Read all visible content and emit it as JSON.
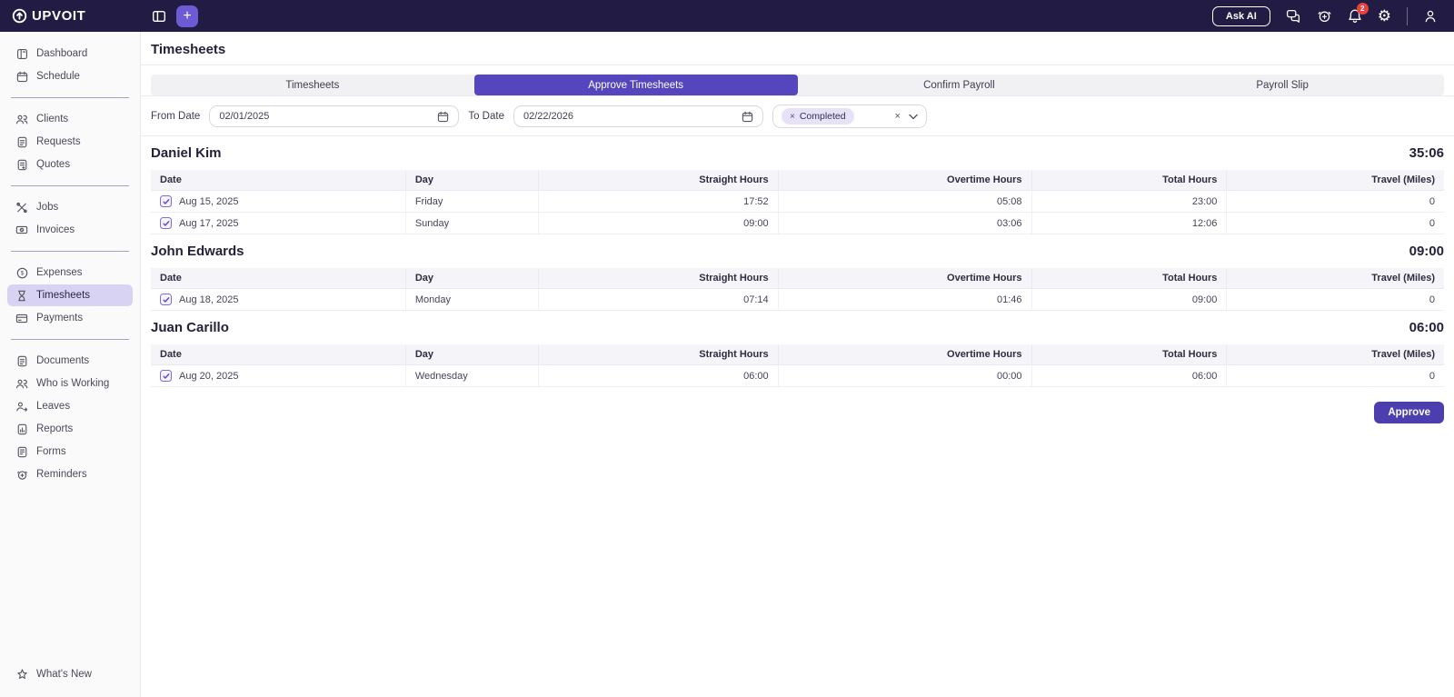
{
  "brand": {
    "name": "UPVOIT"
  },
  "topbar": {
    "ask_ai_label": "Ask AI",
    "notification_count": "2",
    "icons": [
      "panel-toggle-icon",
      "plus-icon",
      "chat-icon",
      "alarm-icon",
      "bell-icon",
      "gear-icon",
      "user-icon"
    ]
  },
  "sidebar": {
    "groups": [
      {
        "items": [
          {
            "label": "Dashboard",
            "icon": "dashboard-icon"
          },
          {
            "label": "Schedule",
            "icon": "schedule-icon"
          }
        ]
      },
      {
        "items": [
          {
            "label": "Clients",
            "icon": "clients-icon"
          },
          {
            "label": "Requests",
            "icon": "requests-icon"
          },
          {
            "label": "Quotes",
            "icon": "quotes-icon"
          }
        ]
      },
      {
        "items": [
          {
            "label": "Jobs",
            "icon": "jobs-icon"
          },
          {
            "label": "Invoices",
            "icon": "invoices-icon"
          }
        ]
      },
      {
        "items": [
          {
            "label": "Expenses",
            "icon": "expenses-icon"
          },
          {
            "label": "Timesheets",
            "icon": "timesheets-icon",
            "active": true
          },
          {
            "label": "Payments",
            "icon": "payments-icon"
          }
        ]
      },
      {
        "items": [
          {
            "label": "Documents",
            "icon": "documents-icon"
          },
          {
            "label": "Who is Working",
            "icon": "who-is-working-icon"
          },
          {
            "label": "Leaves",
            "icon": "leaves-icon"
          },
          {
            "label": "Reports",
            "icon": "reports-icon"
          },
          {
            "label": "Forms",
            "icon": "forms-icon"
          },
          {
            "label": "Reminders",
            "icon": "reminders-icon"
          }
        ]
      }
    ],
    "footer": {
      "label": "What's New",
      "icon": "whats-new-icon"
    }
  },
  "page": {
    "title": "Timesheets"
  },
  "tabs": [
    {
      "label": "Timesheets",
      "active": false
    },
    {
      "label": "Approve Timesheets",
      "active": true
    },
    {
      "label": "Confirm Payroll",
      "active": false
    },
    {
      "label": "Payroll Slip",
      "active": false
    }
  ],
  "filters": {
    "from_date": {
      "label": "From Date",
      "value": "02/01/2025"
    },
    "to_date": {
      "label": "To Date",
      "value": "02/22/2026"
    },
    "status": {
      "chip_label": "Completed"
    }
  },
  "table": {
    "headers": [
      "Date",
      "Day",
      "Straight Hours",
      "Overtime Hours",
      "Total Hours",
      "Travel (Miles)"
    ]
  },
  "employees": [
    {
      "name": "Daniel Kim",
      "total_hours": "35:06",
      "rows": [
        {
          "date": "Aug 15, 2025",
          "day": "Friday",
          "straight_hours": "17:52",
          "overtime_hours": "05:08",
          "total_hours": "23:00",
          "travel_miles": "0",
          "checked": true
        },
        {
          "date": "Aug 17, 2025",
          "day": "Sunday",
          "straight_hours": "09:00",
          "overtime_hours": "03:06",
          "total_hours": "12:06",
          "travel_miles": "0",
          "checked": true
        }
      ]
    },
    {
      "name": "John Edwards",
      "total_hours": "09:00",
      "rows": [
        {
          "date": "Aug 18, 2025",
          "day": "Monday",
          "straight_hours": "07:14",
          "overtime_hours": "01:46",
          "total_hours": "09:00",
          "travel_miles": "0",
          "checked": true
        }
      ]
    },
    {
      "name": "Juan Carillo",
      "total_hours": "06:00",
      "rows": [
        {
          "date": "Aug 20, 2025",
          "day": "Wednesday",
          "straight_hours": "06:00",
          "overtime_hours": "00:00",
          "total_hours": "06:00",
          "travel_miles": "0",
          "checked": true
        }
      ]
    }
  ],
  "actions": {
    "approve_label": "Approve"
  },
  "colors": {
    "topbar_bg": "#221b44",
    "accent_purple": "#5646bd",
    "approve_purple": "#4c3eae",
    "plus_purple": "#6c5bd4",
    "selected_item_bg": "#d8d2f3",
    "badge_red": "#e8413c",
    "table_header_bg": "#f5f4f9",
    "chip_bg": "#e7e2f8"
  }
}
